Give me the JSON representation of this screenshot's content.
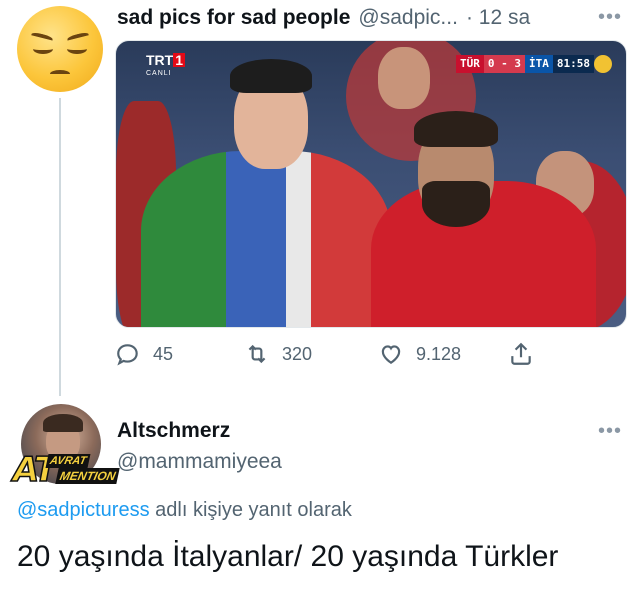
{
  "parent_tweet": {
    "display_name": "sad pics for sad people",
    "handle": "@sadpic...",
    "time": "· 12 sa",
    "avatar_icon": "pensive-face-emoji",
    "photo": {
      "broadcaster_logo": "TRT",
      "broadcaster_logo_number": "1",
      "broadcaster_sublabel": "CANLI",
      "scoreboard": {
        "home": "TÜR",
        "score": "0 - 3",
        "away": "İTA",
        "clock": "81:58"
      }
    },
    "actions": {
      "replies": "45",
      "retweets": "320",
      "likes": "9.128"
    }
  },
  "reply_tweet": {
    "display_name": "Altschmerz",
    "handle": "@mammamiyeea",
    "avatar_badge": {
      "big_letters": "AT",
      "line1": "AVRAT",
      "line2": "MENTION"
    },
    "replying_to_mention": "@sadpicturess",
    "replying_to_suffix": " adlı kişiye yanıt olarak",
    "text": "20 yaşında İtalyanlar/ 20 yaşında Türkler"
  },
  "colors": {
    "text_primary": "#0f1419",
    "text_secondary": "#536471",
    "link": "#1d9bf0",
    "thread_line": "#cfd9de"
  }
}
